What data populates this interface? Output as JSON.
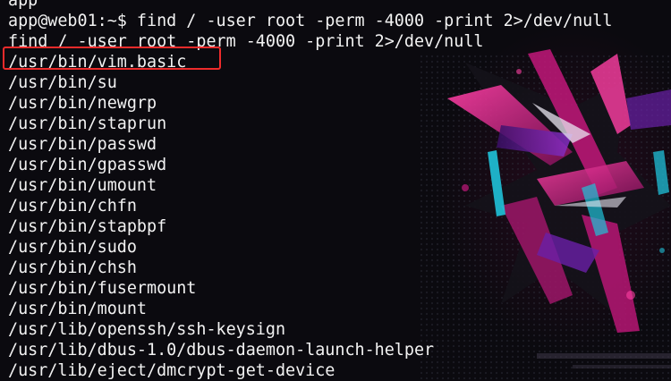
{
  "terminal": {
    "lines": [
      "app",
      "app@web01:~$ find / -user root -perm -4000 -print 2>/dev/null",
      "find / -user root -perm -4000 -print 2>/dev/null",
      "/usr/bin/vim.basic",
      "/usr/bin/su",
      "/usr/bin/newgrp",
      "/usr/bin/staprun",
      "/usr/bin/passwd",
      "/usr/bin/gpasswd",
      "/usr/bin/umount",
      "/usr/bin/chfn",
      "/usr/bin/stapbpf",
      "/usr/bin/sudo",
      "/usr/bin/chsh",
      "/usr/bin/fusermount",
      "/usr/bin/mount",
      "/usr/lib/openssh/ssh-keysign",
      "/usr/lib/dbus-1.0/dbus-daemon-launch-helper",
      "/usr/lib/eject/dmcrypt-get-device"
    ],
    "highlighted_line": "/usr/bin/vim.basic"
  },
  "colors": {
    "background": "#0b0a0f",
    "text": "#f2f2f2",
    "highlight_border": "#ee2b2b",
    "art_magenta": "#c2177a",
    "art_pink": "#ff3fa4",
    "art_cyan": "#1fc2d9",
    "art_purple": "#6a1fa8"
  }
}
